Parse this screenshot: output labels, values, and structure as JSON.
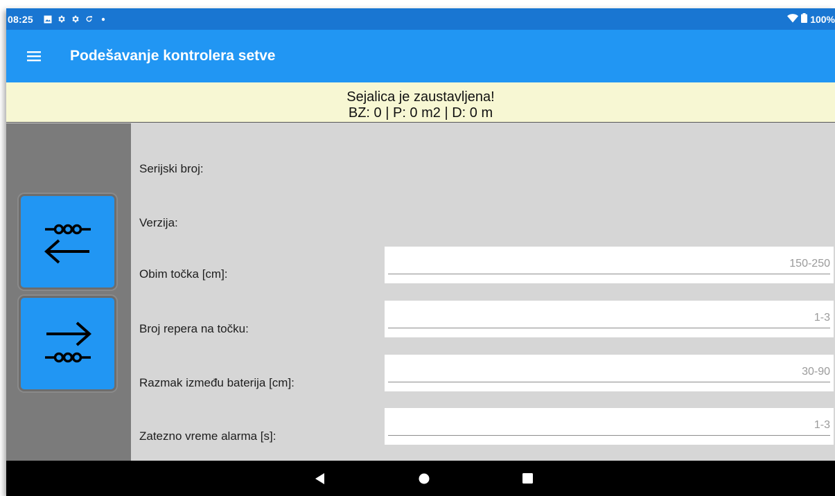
{
  "status_bar": {
    "time": "08:25",
    "icons": [
      "image-icon",
      "settings-icon",
      "settings-icon",
      "sync-icon",
      "dot-icon"
    ],
    "battery": "100%"
  },
  "app_bar": {
    "title": "Podešavanje kontrolera setve"
  },
  "banner": {
    "line1": "Sejalica je zaustavljena!",
    "line2": "BZ: 0 | P: 0 m2 | D: 0 m"
  },
  "side_panel": {
    "buttons": [
      {
        "icon": "back-arrow-icon"
      },
      {
        "icon": "forward-arrow-icon"
      }
    ]
  },
  "form": {
    "serial_label": "Serijski broj:",
    "version_label": "Verzija:",
    "fields": [
      {
        "label": "Obim točka [cm]:",
        "value": "",
        "placeholder": "150-250"
      },
      {
        "label": "Broj repera na točku:",
        "value": "",
        "placeholder": "1-3"
      },
      {
        "label": "Razmak između baterija [cm]:",
        "value": "",
        "placeholder": "30-90"
      },
      {
        "label": "Zatezno vreme alarma [s]:",
        "value": "",
        "placeholder": "1-3"
      }
    ]
  },
  "colors": {
    "status_bar": "#1976d2",
    "app_bar": "#2196f3",
    "banner": "#f7f7d3",
    "side_panel": "#7b7b7b",
    "content": "#d6d6d6",
    "nav_bar": "#000000"
  },
  "nav_bar": {
    "buttons": [
      "back-triangle-icon",
      "home-circle-icon",
      "recents-square-icon"
    ]
  }
}
